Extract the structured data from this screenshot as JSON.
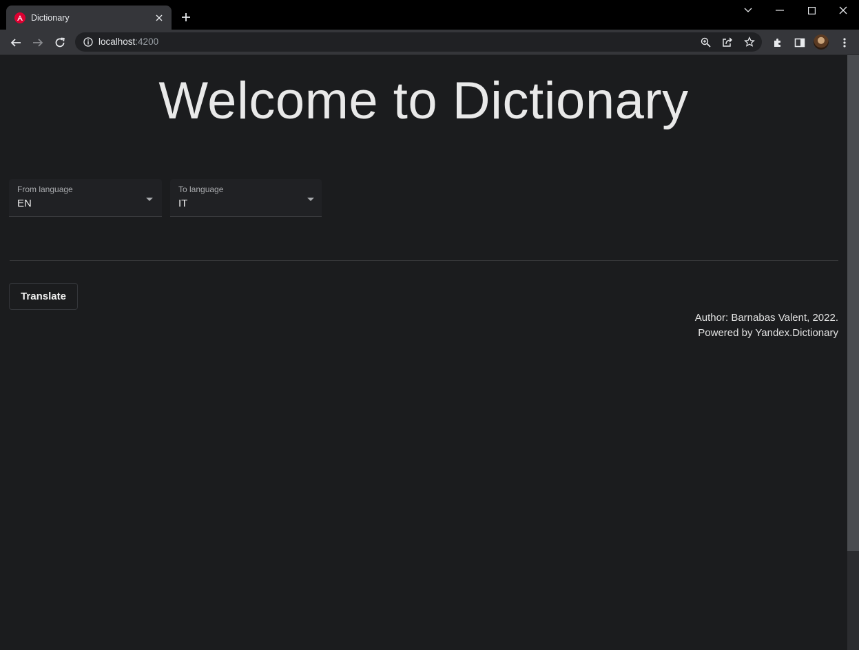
{
  "browser": {
    "tab": {
      "title": "Dictionary",
      "favicon": "angular-icon"
    },
    "url": {
      "host": "localhost",
      "port": ":4200"
    }
  },
  "page": {
    "title": "Welcome to Dictionary",
    "from_language": {
      "label": "From language",
      "value": "EN"
    },
    "to_language": {
      "label": "To language",
      "value": "IT"
    },
    "translate_label": "Translate",
    "footer": {
      "author": "Author: Barnabas Valent, 2022.",
      "powered_by": "Powered by Yandex.Dictionary"
    }
  },
  "colors": {
    "background": "#1b1c1e",
    "chrome_dark": "#000000",
    "chrome_tab": "#35363a",
    "text": "#e9e9e9"
  }
}
